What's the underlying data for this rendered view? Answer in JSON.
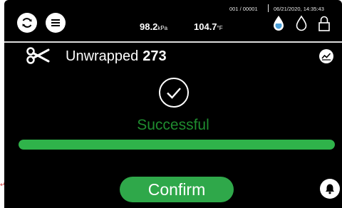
{
  "edge_mark": "↵",
  "header": {
    "cycle_id": "001 / 00001",
    "datetime": "06/21/2020, 14:35:43",
    "pressure": {
      "value": "98.2",
      "unit": "kPa"
    },
    "temperature": {
      "value": "104.7",
      "unit": "°F"
    },
    "icons": [
      "refresh-icon",
      "menu-icon",
      "water-level-icon",
      "water-drop-icon",
      "lock-icon"
    ]
  },
  "load": {
    "label": "Unwrapped",
    "count": "273",
    "icon": "scissors-icon"
  },
  "status": {
    "text": "Successful",
    "progress": 1.0,
    "color": "#2fb34a"
  },
  "actions": {
    "confirm_label": "Confirm",
    "alarm_icon": "bell-icon",
    "chart_icon": "chart-icon"
  }
}
